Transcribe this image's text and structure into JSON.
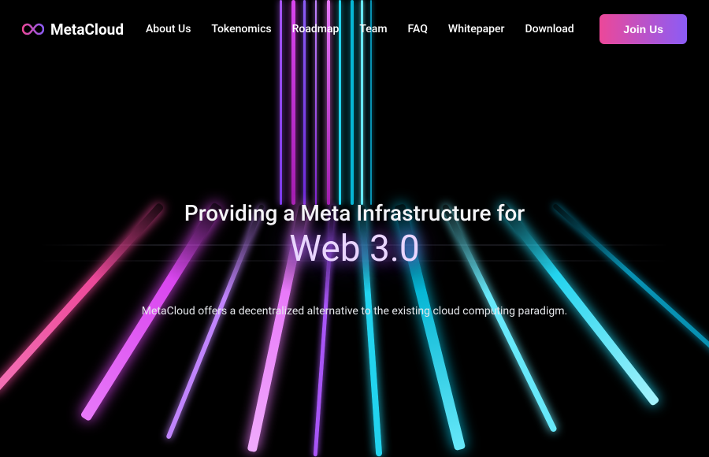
{
  "brand": {
    "name": "MetaCloud"
  },
  "nav": {
    "items": [
      {
        "label": "About Us"
      },
      {
        "label": "Tokenomics"
      },
      {
        "label": "Roadmap"
      },
      {
        "label": "Team"
      },
      {
        "label": "FAQ"
      },
      {
        "label": "Whitepaper"
      },
      {
        "label": "Download"
      }
    ]
  },
  "cta": {
    "label": "Join Us"
  },
  "hero": {
    "line1": "Providing a Meta Infrastructure for",
    "line2": "Web 3.0",
    "subtitle": "MetaCloud offers a decentralized alternative to the existing cloud computing paradigm."
  },
  "colors": {
    "accentPink": "#ec4899",
    "accentPurple": "#8b5cf6",
    "accentCyan": "#22d3ee"
  }
}
